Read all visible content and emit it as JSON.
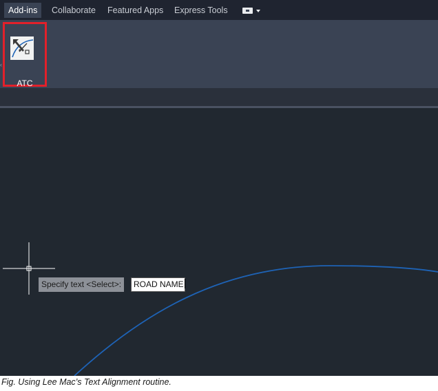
{
  "ribbon": {
    "tabs": [
      {
        "label": "Add-ins",
        "active": true
      },
      {
        "label": "Collaborate",
        "active": false
      },
      {
        "label": "Featured Apps",
        "active": false
      },
      {
        "label": "Express Tools",
        "active": false
      }
    ],
    "panel_menu_icon": "panel-options-icon",
    "tools": [
      {
        "label": "ATC",
        "icon": "text-curve-align-icon",
        "highlighted": true
      }
    ]
  },
  "command": {
    "prompt": "Specify text <Select>:",
    "input_value": "ROAD NAME"
  },
  "caption": "Fig. Using Lee Mac’s Text Alignment routine.",
  "colors": {
    "tab_bar": "#1f2430",
    "ribbon_panel": "#3a4354",
    "canvas_background": "#212830",
    "highlight_box": "#e3202a",
    "arc": "#1e63b6",
    "crosshair": "#ffffff"
  }
}
